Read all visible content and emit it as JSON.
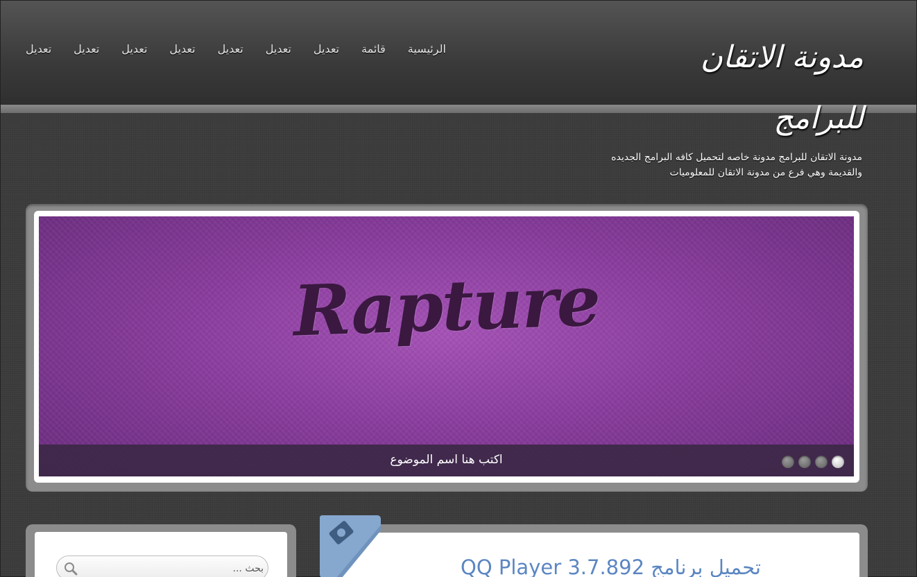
{
  "header": {
    "blog_title": "مدونة الاتقان للبرامج",
    "description": "مدونة الاتقان للبرامج مدونة خاصه لتحميل كافه البرامج الجديده والقديمة وهي فرع من مدونة الاتقان للمعلوميات"
  },
  "nav": {
    "items": [
      {
        "label": "الرئيسية"
      },
      {
        "label": "قائمة"
      },
      {
        "label": "تعديل"
      },
      {
        "label": "تعديل"
      },
      {
        "label": "تعديل"
      },
      {
        "label": "تعديل"
      },
      {
        "label": "تعديل"
      },
      {
        "label": "تعديل"
      },
      {
        "label": "تعديل"
      }
    ]
  },
  "slider": {
    "image_text": "Rapture",
    "caption": "اكتب هنا اسم الموضوع",
    "dot_count": 4,
    "active_dot": 1
  },
  "sidebar": {
    "search_placeholder": "بحث ..."
  },
  "post": {
    "title": "تحميل برنامج QQ Player 3.7.892"
  },
  "colors": {
    "accent_purple": "#8a3d9e",
    "link_blue": "#5b86c2",
    "frame_gray": "#8c8c8c"
  },
  "icons": {
    "search": "search-icon",
    "ribbon": "camera-ribbon-icon"
  }
}
